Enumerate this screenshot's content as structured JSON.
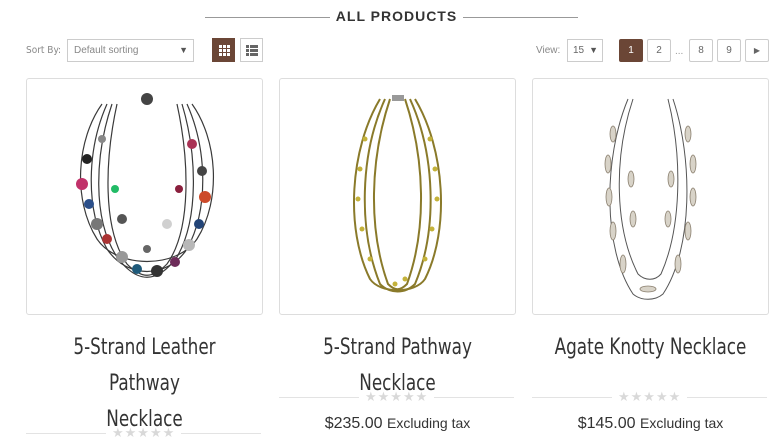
{
  "section": {
    "title": "ALL PRODUCTS"
  },
  "toolbar": {
    "sort_label": "Sort By:",
    "sort_value": "Default sorting",
    "view_label": "View:",
    "view_value": "15"
  },
  "pagination": {
    "pages": [
      "1",
      "2",
      "8",
      "9"
    ],
    "ellipsis": "...",
    "active_page": "1"
  },
  "products": [
    {
      "name": "5-Strand Leather Pathway Necklace",
      "name_line1": "5-Strand Leather Pathway",
      "name_line2": "Necklace",
      "rating": 0,
      "stars": "★★★★★"
    },
    {
      "name": "5-Strand Pathway Necklace",
      "price": "$235.00",
      "tax_label": "Excluding tax",
      "rating": 0,
      "stars": "★★★★★"
    },
    {
      "name": "Agate Knotty Necklace",
      "price": "$145.00",
      "tax_label": "Excluding tax",
      "rating": 0,
      "stars": "★★★★★"
    }
  ],
  "colors": {
    "accent": "#6b4636",
    "border": "#dddddd",
    "star_empty": "#d9d9d9"
  }
}
